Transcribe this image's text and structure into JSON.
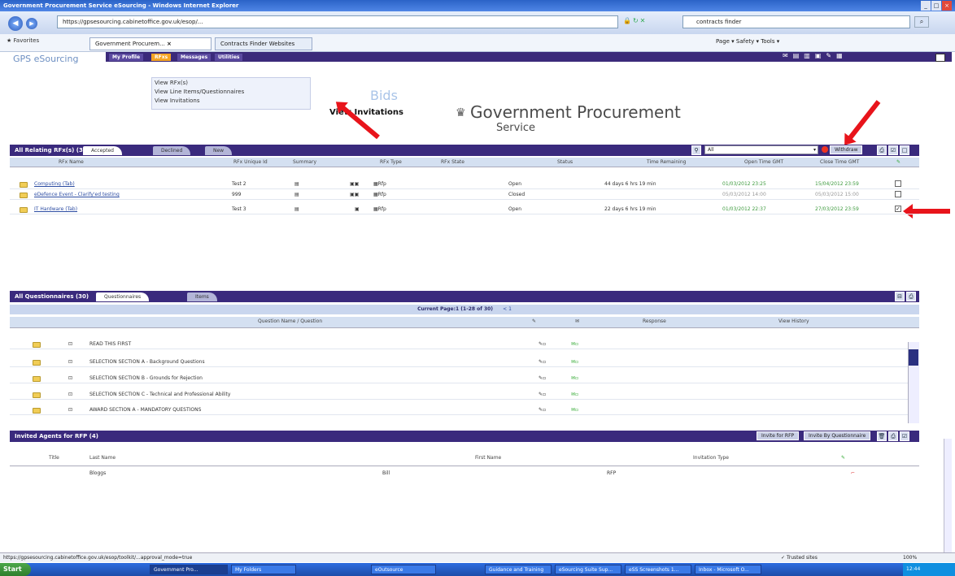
{
  "window": {
    "title": "Government Procurement Service eSourcing - Windows Internet Explorer"
  },
  "browser": {
    "address": "https://gpsesourcing.cabinetoffice.gov.uk/esop/...",
    "search_value": "contracts finder",
    "favorites_label": "Favorites",
    "tabs": [
      "Government Procurem...",
      "Contracts Finder Websites"
    ],
    "tools": "Page ▾  Safety ▾  Tools ▾"
  },
  "app": {
    "logo": "GPS eSourcing",
    "menu": [
      "My Profile",
      "RFxs",
      "Messages",
      "Utilities"
    ],
    "dropdown": [
      "View RFx(s)",
      "View Line Items/Questionnaires",
      "View Invitations"
    ],
    "bids": "Bids",
    "view_invitations": "View Invitations",
    "gps_line1": "Government Procurement",
    "gps_line2": "Service"
  },
  "rfx_section": {
    "title": "All Relating RFx(s) (3)",
    "tabs": [
      "Accepted",
      "Declined",
      "New"
    ],
    "filter_value": "All",
    "withdraw_label": "Withdraw",
    "columns": [
      "RFx Name",
      "RFx Unique Id",
      "Summary",
      "RFx Type",
      "RFx State",
      "Status",
      "Time Remaining",
      "Open Time GMT",
      "Close Time GMT"
    ],
    "rows": [
      {
        "name": "Computing (Tab)",
        "id": "Test 2",
        "type": "Rfp",
        "status": "Open",
        "remaining": "44 days 6 hrs 19 min",
        "open": "01/03/2012 23:25",
        "close": "15/04/2012 23:59",
        "checked": false
      },
      {
        "name": "eDefence Event - Clarify'ed testing",
        "id": "999",
        "type": "Rfp",
        "status": "Closed",
        "remaining": "",
        "open": "05/03/2012 14:00",
        "close": "05/03/2012 15:00",
        "checked": false
      },
      {
        "name": "IT Hardware (Tab)",
        "id": "Test 3",
        "type": "Rfp",
        "status": "Open",
        "remaining": "22 days 6 hrs 19 min",
        "open": "01/03/2012 22:37",
        "close": "27/03/2012 23:59",
        "checked": true
      }
    ]
  },
  "q_section": {
    "title": "All Questionnaires (30)",
    "tabs": [
      "Questionnaires",
      "Items"
    ],
    "page_info": "Current Page:1 (1-28 of 30)",
    "page_links": "< 1",
    "columns": [
      "Question Name / Question",
      "Response",
      "View History"
    ],
    "rows": [
      "READ THIS FIRST",
      "SELECTION SECTION A - Background Questions",
      "SELECTION SECTION B - Grounds for Rejection",
      "SELECTION SECTION C - Technical and Professional Ability",
      "AWARD SECTION A - MANDATORY QUESTIONS"
    ]
  },
  "agents_section": {
    "title": "Invited Agents for RFP (4)",
    "buttons": [
      "Invite for RFP",
      "Invite By Questionnaire"
    ],
    "columns": [
      "Title",
      "Last Name",
      "First Name",
      "Invitation Type"
    ],
    "rows": [
      {
        "title": "",
        "last": "Bloggs",
        "first": "Bill",
        "type": "RFP"
      }
    ]
  },
  "status": {
    "url": "https://gpsesourcing.cabinetoffice.gov.uk/esop/toolkit/...approval_mode=true",
    "zone": "Trusted sites",
    "zoom": "100%"
  },
  "taskbar": {
    "start": "Start",
    "tasks": [
      "Government Pro...",
      "My Folders",
      "eOutsource",
      "Guidance and Training",
      "eSourcing Suite Sup...",
      "eSS Screenshots 1...",
      "Inbox - Microsoft O..."
    ],
    "clock": "12:44"
  }
}
